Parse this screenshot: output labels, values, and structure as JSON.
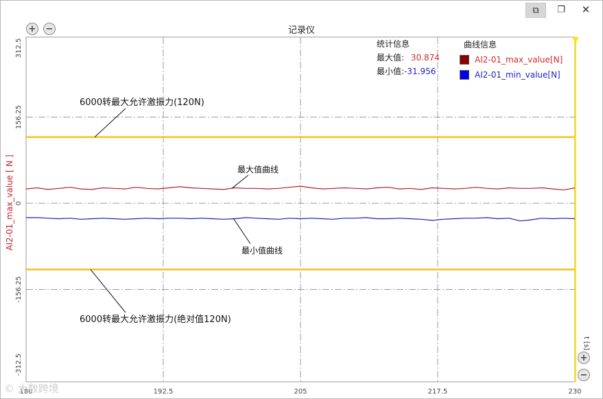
{
  "window": {
    "restore_active_icon": "restore-windows-icon",
    "restore_icon": "restore-icon",
    "close_icon": "close-icon",
    "close_glyph": "✕",
    "restore_glyph": "❐",
    "restore_active_glyph": "⧉"
  },
  "zoom": {
    "in_glyph": "+",
    "out_glyph": "−"
  },
  "watermark": "© 大数跨境",
  "chart_data": {
    "type": "line",
    "title": "记录仪",
    "ylabel": "AI2-01_max_value  [ N ]",
    "xlabel": "t  [s]",
    "xlim": [
      180,
      230
    ],
    "ylim": [
      -312.5,
      312.5
    ],
    "x_ticks": [
      "180",
      "192.5",
      "205",
      "217.5",
      "230"
    ],
    "x_tick_values": [
      180,
      192.5,
      205,
      217.5,
      230
    ],
    "y_ticks": [
      "312.5",
      "156.25",
      "0",
      "-156.25",
      "-312.5"
    ],
    "y_tick_values": [
      312.5,
      156.25,
      0,
      -156.25,
      -312.5
    ],
    "grid": true,
    "legend_placement": "top-right",
    "legend_title": "曲线信息",
    "stats": {
      "title": "统计信息",
      "max_label": "最大值:",
      "max_value": "30.874",
      "min_label": "最小值:",
      "min_value": "-31.956"
    },
    "colors": {
      "max_series": "#b51f2a",
      "min_series": "#1d1bb5",
      "limit_line": "#f2c21a",
      "cursor": "#ffe600",
      "ylabel": "#c0202c",
      "max_text": "#d42a2a",
      "min_text": "#2222c4"
    },
    "series": [
      {
        "name": "AI2-01_max_value[N]",
        "swatch": "#8b0000",
        "x": [
          180,
          181,
          182,
          183,
          184,
          185,
          186,
          187,
          188,
          189,
          190,
          191,
          192,
          193,
          194,
          195,
          196,
          197,
          198,
          199,
          200,
          201,
          202,
          203,
          204,
          205,
          206,
          207,
          208,
          209,
          210,
          211,
          212,
          213,
          214,
          215,
          216,
          217,
          218,
          219,
          220,
          221,
          222,
          223,
          224,
          225,
          226,
          227,
          228,
          229,
          230
        ],
        "values": [
          26,
          28,
          25,
          27,
          29,
          26,
          25,
          28,
          27,
          26,
          29,
          27,
          26,
          28,
          30,
          28,
          27,
          26,
          25,
          28,
          27,
          27,
          26,
          27,
          29,
          31,
          28,
          26,
          27,
          28,
          27,
          26,
          28,
          29,
          26,
          27,
          25,
          28,
          27,
          26,
          27,
          29,
          27,
          26,
          28,
          27,
          27,
          28,
          26,
          24,
          28
        ]
      },
      {
        "name": "AI2-01_min_value[N]",
        "swatch": "#0000ee",
        "x": [
          180,
          181,
          182,
          183,
          184,
          185,
          186,
          187,
          188,
          189,
          190,
          191,
          192,
          193,
          194,
          195,
          196,
          197,
          198,
          199,
          200,
          201,
          202,
          203,
          204,
          205,
          206,
          207,
          208,
          209,
          210,
          211,
          212,
          213,
          214,
          215,
          216,
          217,
          218,
          219,
          220,
          221,
          222,
          223,
          224,
          225,
          226,
          227,
          228,
          229,
          230
        ],
        "values": [
          -26,
          -26,
          -27,
          -28,
          -27,
          -29,
          -28,
          -27,
          -28,
          -29,
          -28,
          -27,
          -28,
          -27,
          -27,
          -28,
          -27,
          -28,
          -29,
          -28,
          -26,
          -27,
          -28,
          -29,
          -27,
          -28,
          -27,
          -28,
          -29,
          -27,
          -27,
          -26,
          -28,
          -28,
          -27,
          -28,
          -29,
          -31,
          -29,
          -28,
          -27,
          -27,
          -26,
          -28,
          -27,
          -32,
          -30,
          -27,
          -28,
          -27,
          -28
        ]
      }
    ],
    "limit_lines": [
      {
        "y": 120,
        "label": "6000转最大允许激振力(120N)"
      },
      {
        "y": -120,
        "label": "6000转最大允许激振力(绝对值120N)"
      }
    ],
    "annotations": [
      {
        "label": "最大值曲线"
      },
      {
        "label": "最小值曲线"
      }
    ]
  }
}
